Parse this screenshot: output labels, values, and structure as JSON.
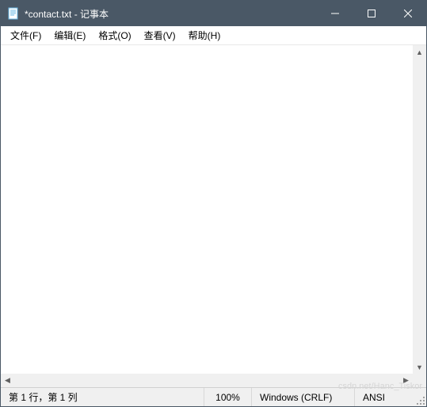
{
  "titlebar": {
    "filename": "*contact.txt - 记事本"
  },
  "menubar": {
    "file": "文件(F)",
    "edit": "编辑(E)",
    "format": "格式(O)",
    "view": "查看(V)",
    "help": "帮助(H)"
  },
  "editor": {
    "content": ""
  },
  "statusbar": {
    "position": "第 1 行，第 1 列",
    "zoom": "100%",
    "line_ending": "Windows (CRLF)",
    "encoding": "ANSI"
  },
  "watermark": "csdn.net/Hanc_Tiskor"
}
